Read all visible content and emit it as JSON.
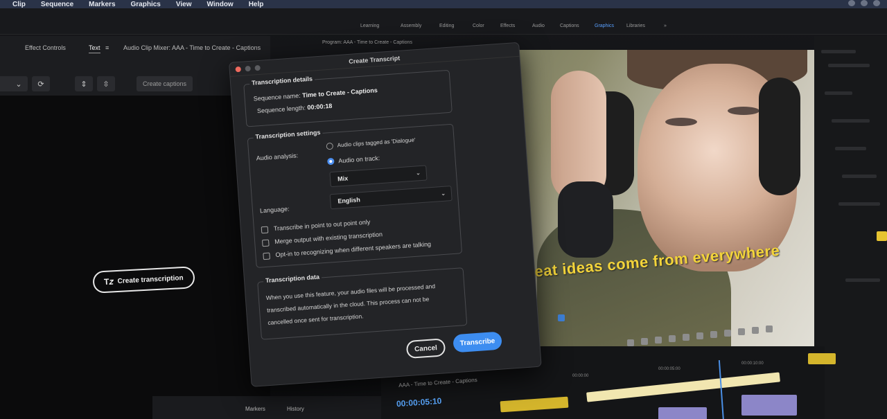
{
  "menubar": {
    "items": [
      "Clip",
      "Sequence",
      "Markers",
      "Graphics",
      "View",
      "Window",
      "Help"
    ]
  },
  "workspaces": {
    "items": [
      "Learning",
      "Assembly",
      "Editing",
      "Color",
      "Effects",
      "Audio",
      "Captions",
      "Graphics",
      "Libraries"
    ]
  },
  "left_panel": {
    "tabs": [
      "Effect Controls",
      "Text",
      "Audio Clip Mixer: AAA - Time to Create - Captions"
    ],
    "tab_menu_icon": "hamburger-icon",
    "create_captions_label": "Create captions",
    "create_transcription_label": "Create transcription",
    "create_transcription_icon": "text-transcript-icon"
  },
  "bottom_strip": {
    "tabs": [
      "Markers",
      "History"
    ]
  },
  "program_monitor": {
    "title": "Program: AAA - Time to Create - Captions",
    "caption_overlay": "Great ideas come from everywhere"
  },
  "dialog": {
    "title": "Create Transcript",
    "details": {
      "heading": "Transcription details",
      "sequence_name_label": "Sequence name:",
      "sequence_name_value": "Time to Create - Captions",
      "sequence_length_label": "Sequence length:",
      "sequence_length_value": "00:00:18"
    },
    "settings": {
      "heading": "Transcription settings",
      "audio_analysis_label": "Audio analysis:",
      "option_dialogue": "Audio clips tagged as 'Dialogue'",
      "option_track": "Audio on track:",
      "track_value": "Mix",
      "language_label": "Language:",
      "language_value": "English",
      "check_in_out": "Transcribe in point to out point only",
      "check_merge": "Merge output with existing transcription",
      "check_speakers": "Opt-in to recognizing when different speakers are talking"
    },
    "data": {
      "heading": "Transcription data",
      "line1": "When you use this feature, your audio files will be processed and",
      "line2": "transcribed automatically in the cloud. This process can not be",
      "line3": "cancelled once sent for transcription."
    },
    "cancel_label": "Cancel",
    "transcribe_label": "Transcribe"
  },
  "timeline": {
    "sequence_tab": "AAA - Time to Create - Captions",
    "timecode": "00:00:05:10",
    "ruler": [
      "00:00:00",
      "00:00:05:00",
      "00:00:10:00"
    ]
  },
  "colors": {
    "accent": "#3d8df0",
    "caption_yellow": "#f3d43a",
    "timecode_blue": "#5aa8ff"
  }
}
